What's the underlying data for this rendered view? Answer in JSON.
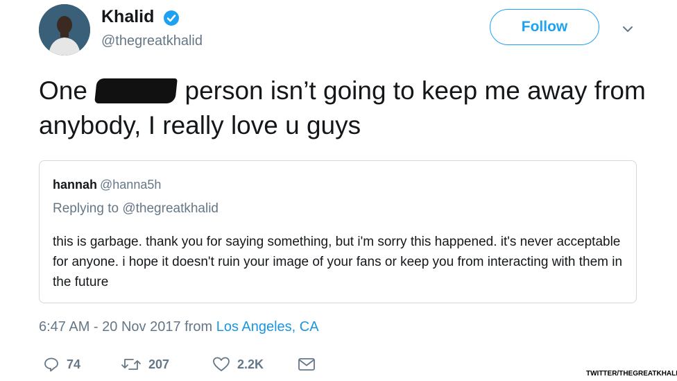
{
  "author": {
    "name": "Khalid",
    "handle": "@thegreatkhalid",
    "verified_icon": "verified-badge-icon",
    "avatar_icon": "profile-photo"
  },
  "follow_button": {
    "label": "Follow"
  },
  "more_menu_icon": "chevron-down-icon",
  "tweet": {
    "text_before": "One",
    "text_after": "person isn’t going to keep me away from anybody, I really love u guys",
    "redaction": "redacted-word"
  },
  "quoted_tweet": {
    "name": "hannah",
    "handle": "@hanna5h",
    "replying_prefix": "Replying to",
    "replying_to": "@thegreatkhalid",
    "text": "this is garbage. thank you for saying something, but i'm sorry this happened. it's never acceptable for anyone. i hope it doesn't ruin your image of your fans or keep you from interacting with them in the future"
  },
  "meta": {
    "time": "6:47 AM - 20 Nov 2017 from",
    "location": "Los Angeles, CA"
  },
  "actions": {
    "replies": "74",
    "retweets": "207",
    "likes": "2.2K",
    "reply_icon": "reply-icon",
    "retweet_icon": "retweet-icon",
    "like_icon": "heart-icon",
    "dm_icon": "envelope-icon"
  },
  "credit": "TWITTER/THEGREATKHALID",
  "colors": {
    "accent": "#1da1f2",
    "muted": "#657786",
    "text": "#14171a"
  }
}
